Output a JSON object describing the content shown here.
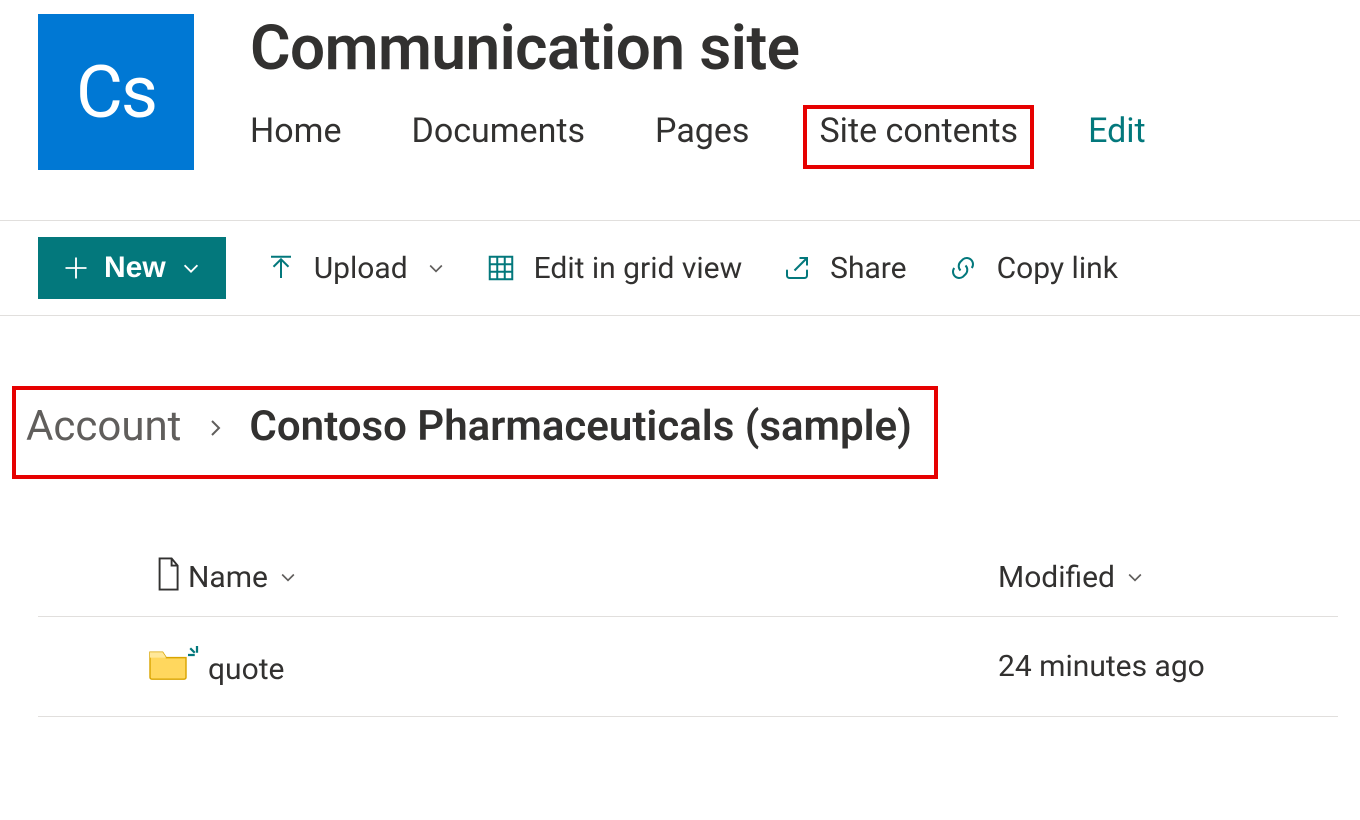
{
  "site": {
    "logo_text": "Cs",
    "title": "Communication site",
    "nav": {
      "home": "Home",
      "documents": "Documents",
      "pages": "Pages",
      "site_contents": "Site contents",
      "edit": "Edit"
    }
  },
  "command_bar": {
    "new": "New",
    "upload": "Upload",
    "edit_grid": "Edit in grid view",
    "share": "Share",
    "copy_link": "Copy link"
  },
  "breadcrumb": {
    "root": "Account",
    "leaf": "Contoso Pharmaceuticals (sample)"
  },
  "list": {
    "columns": {
      "name": "Name",
      "modified": "Modified"
    },
    "rows": [
      {
        "name": "quote",
        "modified": "24 minutes ago",
        "type": "folder",
        "is_new": true
      }
    ]
  },
  "colors": {
    "accent": "#03787c",
    "brand_blue": "#0078d4",
    "highlight_red": "#e60000"
  }
}
